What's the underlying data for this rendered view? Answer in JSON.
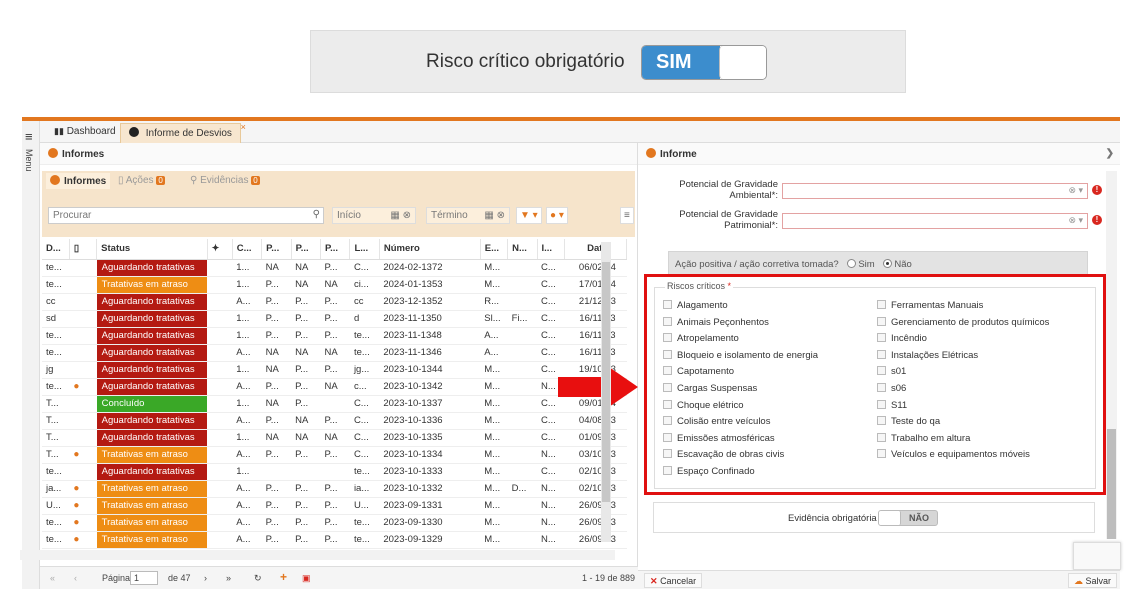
{
  "banner": {
    "label": "Risco crítico obrigatório",
    "toggle_on_text": "SIM"
  },
  "app": {
    "menu_label": "Menu",
    "tabs": [
      {
        "label": "Dashboard"
      },
      {
        "label": "Informe de Desvios"
      }
    ],
    "left_panel_title": "Informes",
    "subtabs": [
      {
        "label": "Informes"
      },
      {
        "label": "Ações",
        "badge": "0"
      },
      {
        "label": "Evidências",
        "badge": "0"
      }
    ],
    "search_placeholder": "Procurar",
    "inicio_placeholder": "Início",
    "termino_placeholder": "Término",
    "columns": [
      "D...",
      "",
      "Status",
      "",
      "C...",
      "P...",
      "P...",
      "P...",
      "L...",
      "Número",
      "E...",
      "N...",
      "I...",
      "Data"
    ],
    "rows": [
      {
        "d": "te...",
        "icon": "",
        "status": "Aguardando tratativas",
        "c": "1...",
        "p1": "NA",
        "p2": "NA",
        "p3": "P...",
        "l": "C...",
        "numero": "2024-02-1372",
        "e": "M...",
        "n": "",
        "i": "C...",
        "data": "06/02/24"
      },
      {
        "d": "te...",
        "icon": "",
        "status": "Tratativas em atraso",
        "c": "1...",
        "p1": "P...",
        "p2": "NA",
        "p3": "NA",
        "l": "ci...",
        "numero": "2024-01-1353",
        "e": "M...",
        "n": "",
        "i": "C...",
        "data": "17/01/24"
      },
      {
        "d": "cc",
        "icon": "",
        "status": "Aguardando tratativas",
        "c": "A...",
        "p1": "P...",
        "p2": "P...",
        "p3": "P...",
        "l": "cc",
        "numero": "2023-12-1352",
        "e": "R...",
        "n": "",
        "i": "C...",
        "data": "21/12/23"
      },
      {
        "d": "sd",
        "icon": "",
        "status": "Aguardando tratativas",
        "c": "1...",
        "p1": "P...",
        "p2": "P...",
        "p3": "P...",
        "l": "d",
        "numero": "2023-11-1350",
        "e": "Sl...",
        "n": "Fi...",
        "i": "C...",
        "data": "16/11/23"
      },
      {
        "d": "te...",
        "icon": "",
        "status": "Aguardando tratativas",
        "c": "1...",
        "p1": "P...",
        "p2": "P...",
        "p3": "P...",
        "l": "te...",
        "numero": "2023-11-1348",
        "e": "A...",
        "n": "",
        "i": "C...",
        "data": "16/11/23"
      },
      {
        "d": "te...",
        "icon": "",
        "status": "Aguardando tratativas",
        "c": "A...",
        "p1": "NA",
        "p2": "NA",
        "p3": "NA",
        "l": "te...",
        "numero": "2023-11-1346",
        "e": "A...",
        "n": "",
        "i": "C...",
        "data": "16/11/23"
      },
      {
        "d": "jg",
        "icon": "",
        "status": "Aguardando tratativas",
        "c": "1...",
        "p1": "NA",
        "p2": "P...",
        "p3": "P...",
        "l": "jg...",
        "numero": "2023-10-1344",
        "e": "M...",
        "n": "",
        "i": "C...",
        "data": "19/10/23"
      },
      {
        "d": "te...",
        "icon": "burger",
        "status": "Aguardando tratativas",
        "c": "A...",
        "p1": "P...",
        "p2": "P...",
        "p3": "NA",
        "l": "c...",
        "numero": "2023-10-1342",
        "e": "M...",
        "n": "",
        "i": "N...",
        "data": ""
      },
      {
        "d": "T...",
        "icon": "",
        "status": "Concluído",
        "c": "1...",
        "p1": "NA",
        "p2": "P...",
        "p3": "",
        "l": "C...",
        "numero": "2023-10-1337",
        "e": "M...",
        "n": "",
        "i": "C...",
        "data": "09/01/24"
      },
      {
        "d": "T...",
        "icon": "",
        "status": "Aguardando tratativas",
        "c": "A...",
        "p1": "P...",
        "p2": "NA",
        "p3": "P...",
        "l": "C...",
        "numero": "2023-10-1336",
        "e": "M...",
        "n": "",
        "i": "C...",
        "data": "04/08/23"
      },
      {
        "d": "T...",
        "icon": "",
        "status": "Aguardando tratativas",
        "c": "1...",
        "p1": "NA",
        "p2": "NA",
        "p3": "NA",
        "l": "C...",
        "numero": "2023-10-1335",
        "e": "M...",
        "n": "",
        "i": "C...",
        "data": "01/09/23"
      },
      {
        "d": "T...",
        "icon": "burger",
        "status": "Tratativas em atraso",
        "c": "A...",
        "p1": "P...",
        "p2": "P...",
        "p3": "P...",
        "l": "C...",
        "numero": "2023-10-1334",
        "e": "M...",
        "n": "",
        "i": "N...",
        "data": "03/10/23"
      },
      {
        "d": "te...",
        "icon": "",
        "status": "Aguardando tratativas",
        "c": "1...",
        "p1": "",
        "p2": "",
        "p3": "",
        "l": "te...",
        "numero": "2023-10-1333",
        "e": "M...",
        "n": "",
        "i": "C...",
        "data": "02/10/23"
      },
      {
        "d": "ja...",
        "icon": "burger",
        "status": "Tratativas em atraso",
        "c": "A...",
        "p1": "P...",
        "p2": "P...",
        "p3": "P...",
        "l": "ia...",
        "numero": "2023-10-1332",
        "e": "M...",
        "n": "D...",
        "i": "N...",
        "data": "02/10/23"
      },
      {
        "d": "U...",
        "icon": "burger",
        "status": "Tratativas em atraso",
        "c": "A...",
        "p1": "P...",
        "p2": "P...",
        "p3": "P...",
        "l": "U...",
        "numero": "2023-09-1331",
        "e": "M...",
        "n": "",
        "i": "N...",
        "data": "26/09/23"
      },
      {
        "d": "te...",
        "icon": "burger",
        "status": "Tratativas em atraso",
        "c": "A...",
        "p1": "P...",
        "p2": "P...",
        "p3": "P...",
        "l": "te...",
        "numero": "2023-09-1330",
        "e": "M...",
        "n": "",
        "i": "N...",
        "data": "26/09/23"
      },
      {
        "d": "te...",
        "icon": "burger",
        "status": "Tratativas em atraso",
        "c": "A...",
        "p1": "P...",
        "p2": "P...",
        "p3": "P...",
        "l": "te...",
        "numero": "2023-09-1329",
        "e": "M...",
        "n": "",
        "i": "N...",
        "data": "26/09/23"
      }
    ],
    "status_colors": {
      "Aguardando tratativas": "#b41a12",
      "Tratativas em atraso": "#ee8d14",
      "Concluído": "#3aa827"
    },
    "pager": {
      "page_label": "Página",
      "page_value": "1",
      "of_label": "de 47",
      "range": "1 - 19 de 889"
    },
    "right_panel_title": "Informe",
    "fields": [
      {
        "label": "Potencial de Gravidade Ambiental*:"
      },
      {
        "label": "Potencial de Gravidade Patrimonial*:"
      }
    ],
    "acao_question": "Ação positiva / ação corretiva tomada?",
    "acao_options": [
      "Sim",
      "Não"
    ],
    "acao_selected": "Não",
    "riscos_legend": "Riscos críticos",
    "riscos_left": [
      "Alagamento",
      "Animais Peçonhentos",
      "Atropelamento",
      "Bloqueio e isolamento de energia",
      "Capotamento",
      "Cargas Suspensas",
      "Choque elétrico",
      "Colisão entre veículos",
      "Emissões atmosféricas",
      "Escavação de obras civis",
      "Espaço Confinado"
    ],
    "riscos_right": [
      "Ferramentas Manuais",
      "Gerenciamento de produtos químicos",
      "Incêndio",
      "Instalações Elétricas",
      "s01",
      "s06",
      "S11",
      "Teste do qa",
      "Trabalho em altura",
      "Veículos e equipamentos móveis"
    ],
    "evidencia_label": "Evidência obrigatória",
    "evidencia_toggle": "NÃO",
    "cancel_label": "Cancelar",
    "save_label": "Salvar",
    "accent_color": "#e2771f"
  }
}
